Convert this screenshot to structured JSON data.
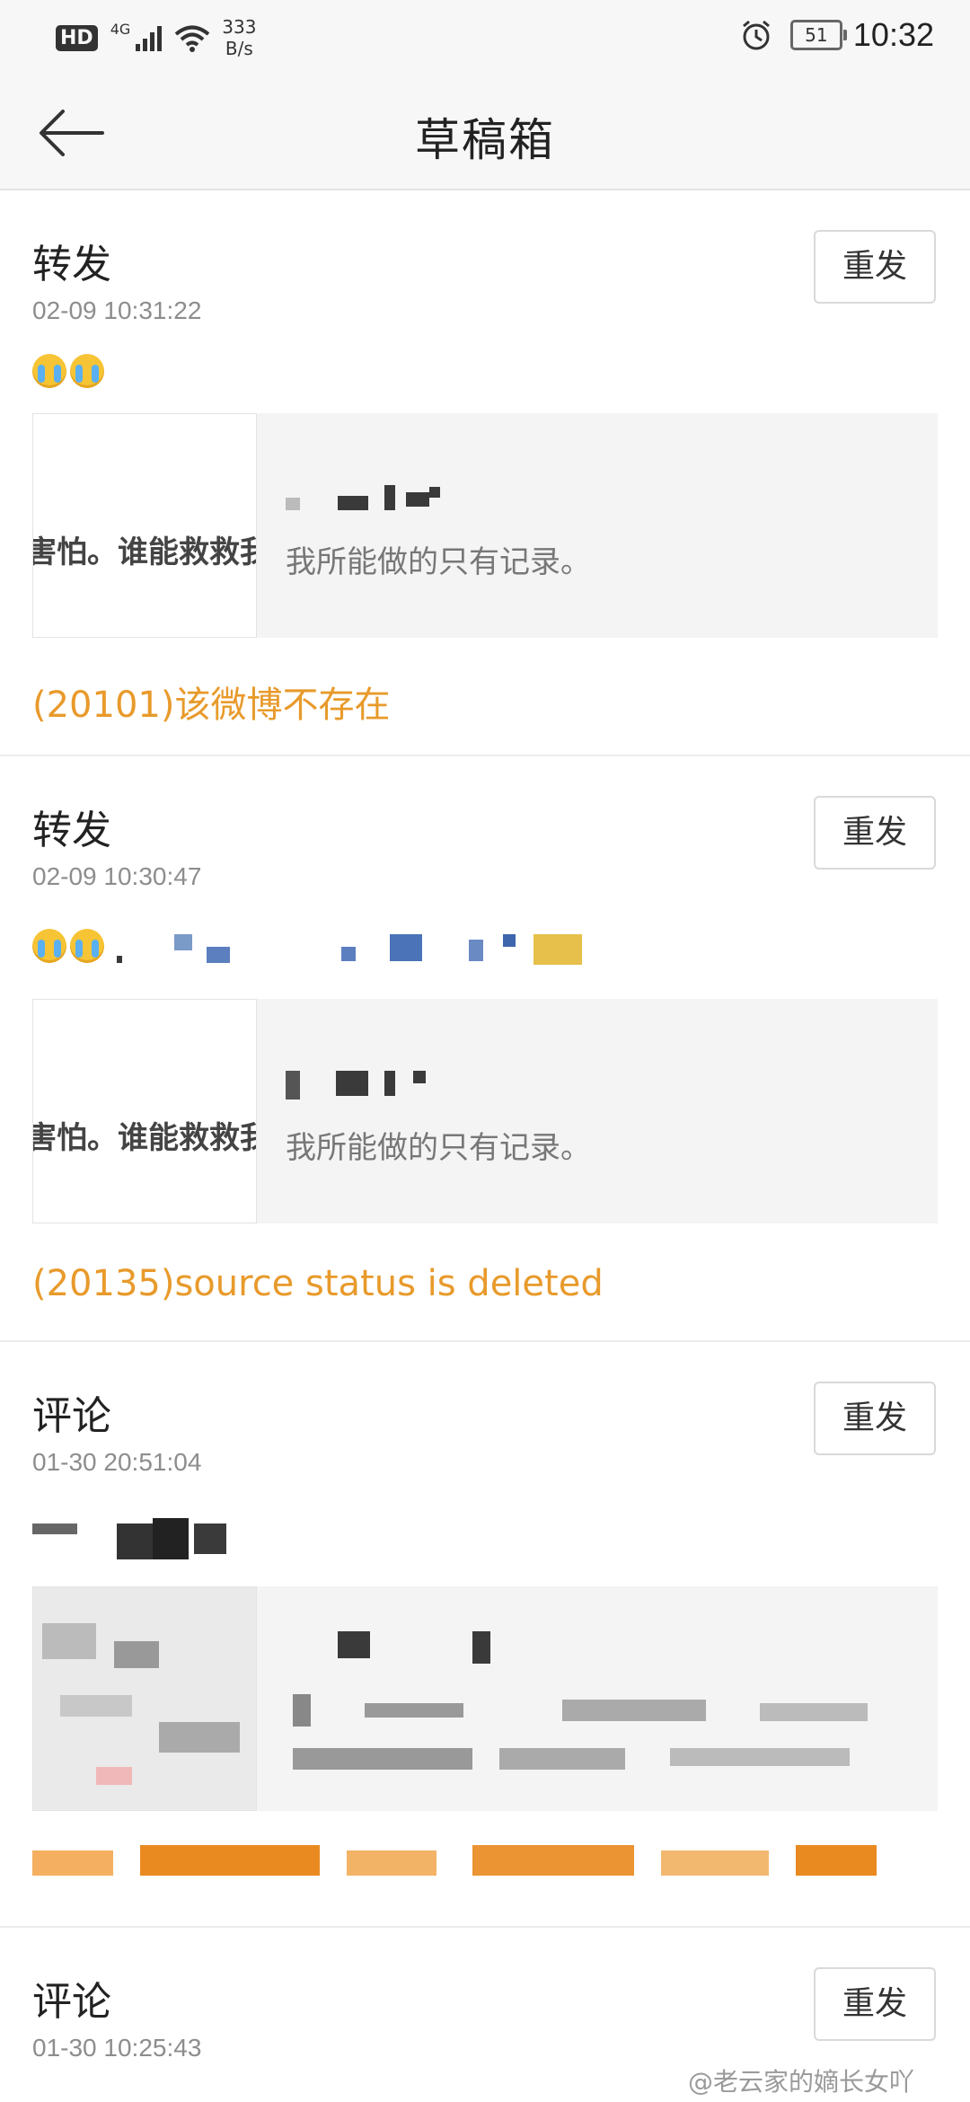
{
  "status_bar": {
    "hd": "HD",
    "network": "4G",
    "speed_value": "333",
    "speed_unit": "B/s",
    "battery": "51",
    "time": "10:32"
  },
  "header": {
    "title": "草稿箱"
  },
  "drafts": [
    {
      "type": "转发",
      "time": "02-09 10:31:22",
      "resend_label": "重发",
      "card_thumb_text": "害怕。谁能救救我",
      "card_desc": "我所能做的只有记录。",
      "error": "(20101)该微博不存在"
    },
    {
      "type": "转发",
      "time": "02-09 10:30:47",
      "resend_label": "重发",
      "card_thumb_text": "害怕。谁能救救我",
      "card_desc": "我所能做的只有记录。",
      "error": "(20135)source status is deleted"
    },
    {
      "type": "评论",
      "time": "01-30 20:51:04",
      "resend_label": "重发"
    },
    {
      "type": "评论",
      "time": "01-30 10:25:43",
      "resend_label": "重发"
    }
  ],
  "watermark": "@老云家的嫡长女吖",
  "colors": {
    "error": "#e89a2b",
    "background": "#ffffff",
    "header_bg": "#f7f7f7"
  }
}
